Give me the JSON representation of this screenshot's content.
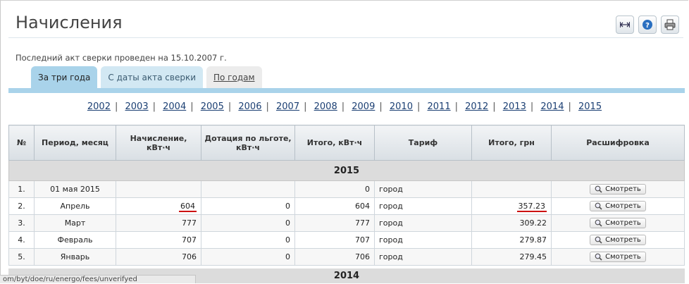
{
  "page": {
    "title": "Начисления",
    "info": "Последний акт сверки проведен на 15.10.2007 г."
  },
  "tools": [
    {
      "name": "expand-icon"
    },
    {
      "name": "help-icon"
    },
    {
      "name": "print-icon"
    }
  ],
  "tabs": [
    {
      "label": "За три года",
      "active": true
    },
    {
      "label": "С даты акта сверки",
      "active": false
    },
    {
      "label": "По годам",
      "active": false
    }
  ],
  "years": [
    "2002",
    "2003",
    "2004",
    "2005",
    "2006",
    "2007",
    "2008",
    "2009",
    "2010",
    "2011",
    "2012",
    "2013",
    "2014",
    "2015"
  ],
  "table": {
    "headers": [
      "№",
      "Период, месяц",
      "Начисление, кВт·ч",
      "Дотация по льготе, кВт·ч",
      "Итого, кВт·ч",
      "Тариф",
      "Итого, грн",
      "Расшифровка"
    ],
    "group": "2015",
    "rows": [
      {
        "n": "1.",
        "period": "01 мая 2015",
        "charge": "",
        "subsidy": "",
        "total_kwh": "0",
        "tariff": "город",
        "total_uah": "",
        "action": "Смотреть"
      },
      {
        "n": "2.",
        "period": "Апрель",
        "charge": "604",
        "subsidy": "0",
        "total_kwh": "604",
        "tariff": "город",
        "total_uah": "357.23",
        "action": "Смотреть"
      },
      {
        "n": "3.",
        "period": "Март",
        "charge": "777",
        "subsidy": "0",
        "total_kwh": "777",
        "tariff": "город",
        "total_uah": "309.22",
        "action": "Смотреть"
      },
      {
        "n": "4.",
        "period": "Февраль",
        "charge": "707",
        "subsidy": "0",
        "total_kwh": "707",
        "tariff": "город",
        "total_uah": "279.87",
        "action": "Смотреть"
      },
      {
        "n": "5.",
        "period": "Январь",
        "charge": "706",
        "subsidy": "0",
        "total_kwh": "706",
        "tariff": "город",
        "total_uah": "279.45",
        "action": "Смотреть"
      }
    ],
    "next_group": "2014"
  },
  "status_bar": "om/byt/doe/ru/energo/fees/unverifyed",
  "colors": {
    "tab_active": "#a9d3ea",
    "link": "#1b3f73",
    "annotation": "#cc1111"
  }
}
